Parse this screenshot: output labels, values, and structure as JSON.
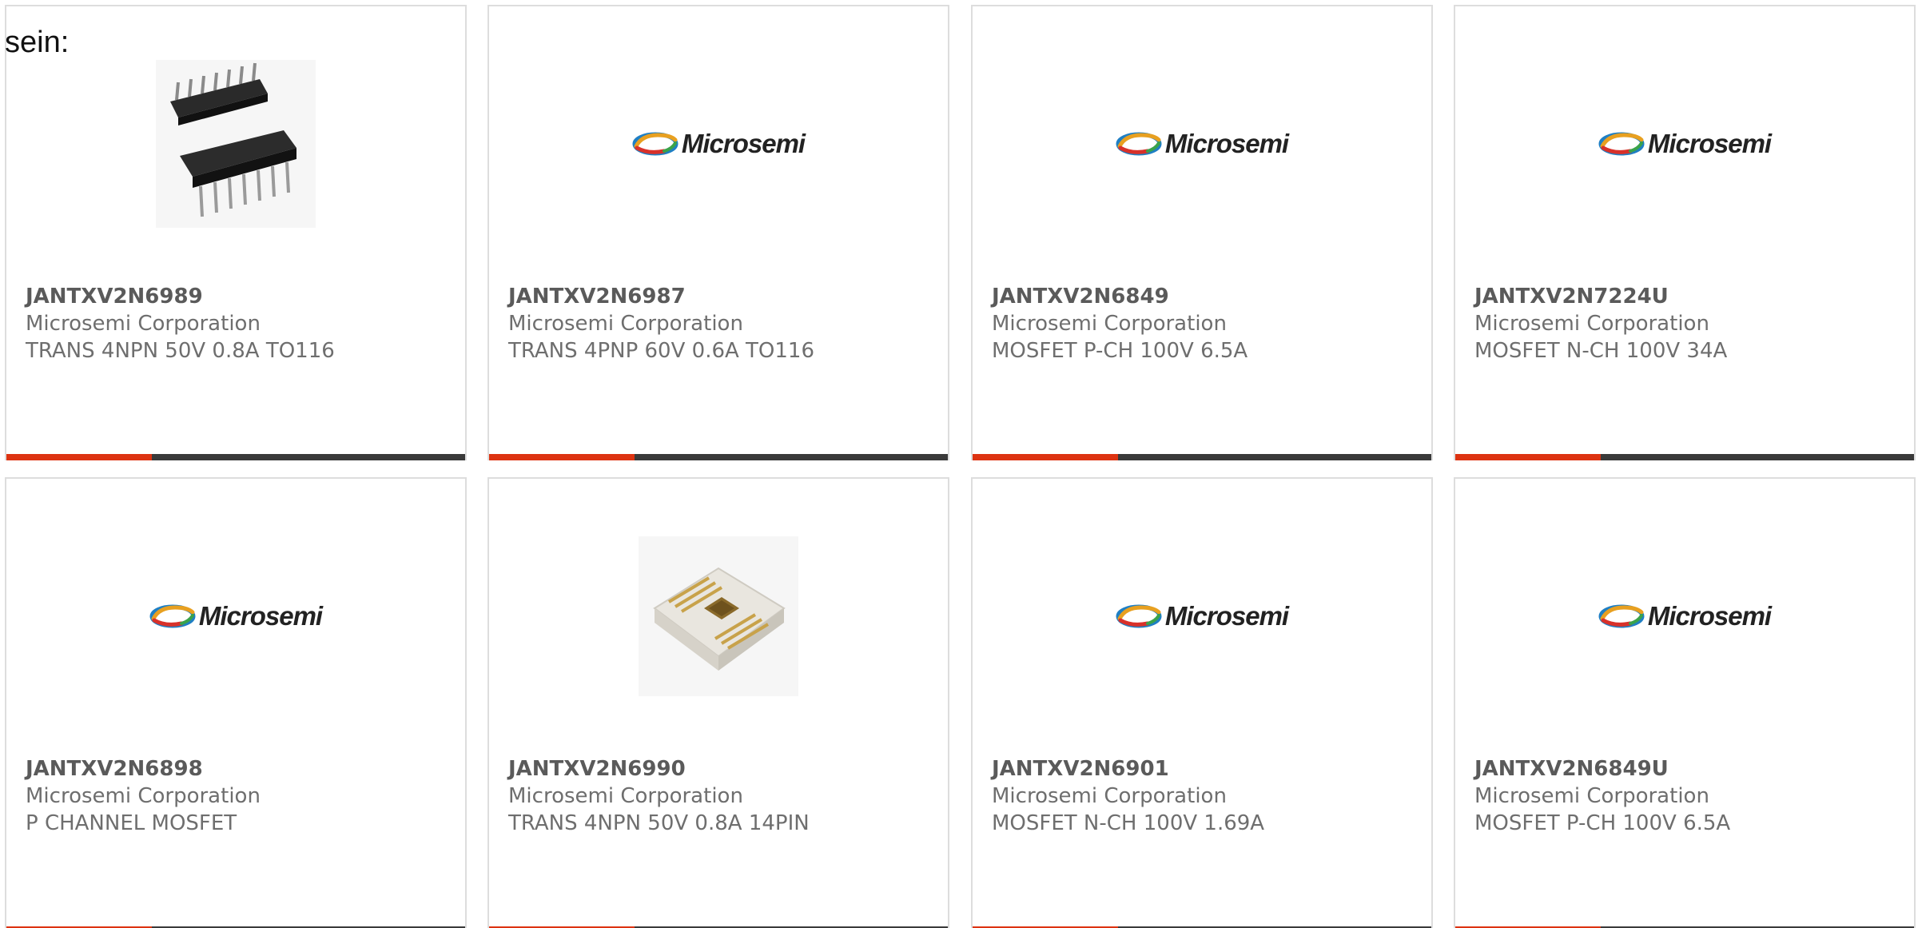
{
  "intro_text": "sein:",
  "brand_logo_text": "Microsemi",
  "colors": {
    "accent": "#dd3311",
    "bar_dark": "#3a3a3a",
    "card_border": "#dddddd",
    "text_muted": "#6e6e6e"
  },
  "products": [
    {
      "part_number": "JANTXV2N6989",
      "manufacturer": "Microsemi Corporation",
      "description": "TRANS 4NPN 50V 0.8A TO116",
      "image": "dip-14-package-icon"
    },
    {
      "part_number": "JANTXV2N6987",
      "manufacturer": "Microsemi Corporation",
      "description": "TRANS 4PNP 60V 0.6A TO116",
      "image": "microsemi-logo"
    },
    {
      "part_number": "JANTXV2N6849",
      "manufacturer": "Microsemi Corporation",
      "description": "MOSFET P-CH 100V 6.5A",
      "image": "microsemi-logo"
    },
    {
      "part_number": "JANTXV2N7224U",
      "manufacturer": "Microsemi Corporation",
      "description": "MOSFET N-CH 100V 34A",
      "image": "microsemi-logo"
    },
    {
      "part_number": "JANTXV2N6898",
      "manufacturer": "Microsemi Corporation",
      "description": "P CHANNEL MOSFET",
      "image": "microsemi-logo"
    },
    {
      "part_number": "JANTXV2N6990",
      "manufacturer": "Microsemi Corporation",
      "description": "TRANS 4NPN 50V 0.8A 14PIN",
      "image": "flatpack-package-icon"
    },
    {
      "part_number": "JANTXV2N6901",
      "manufacturer": "Microsemi Corporation",
      "description": "MOSFET N-CH 100V 1.69A",
      "image": "microsemi-logo"
    },
    {
      "part_number": "JANTXV2N6849U",
      "manufacturer": "Microsemi Corporation",
      "description": "MOSFET P-CH 100V 6.5A",
      "image": "microsemi-logo"
    }
  ]
}
